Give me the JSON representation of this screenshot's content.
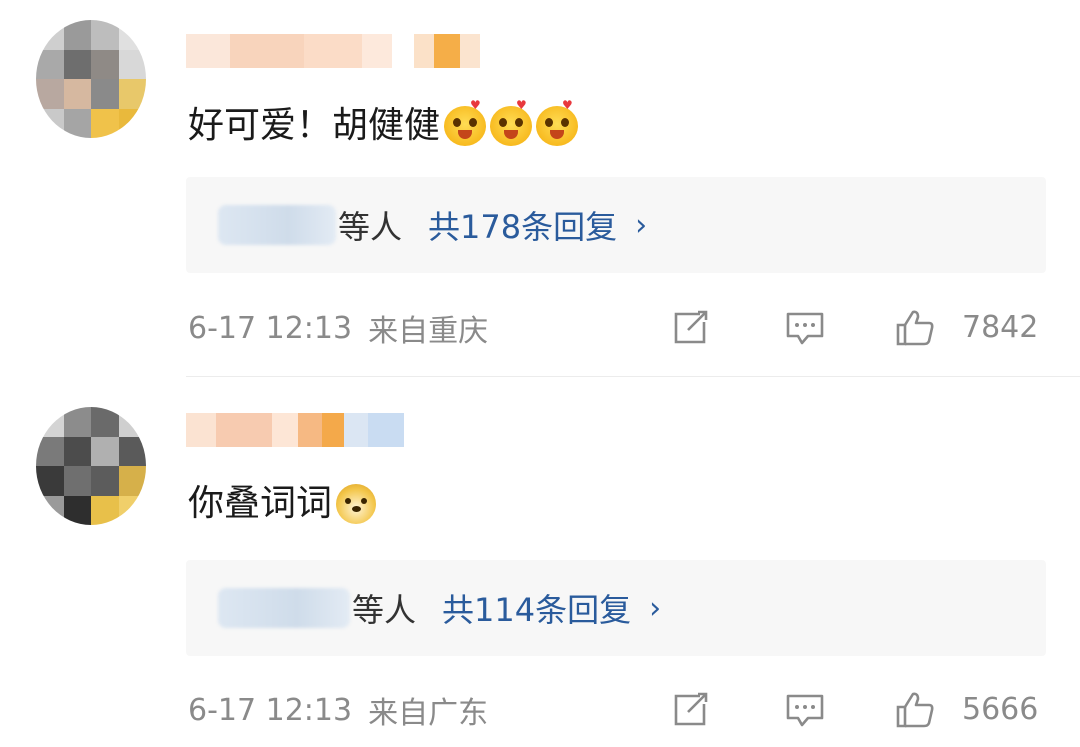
{
  "comments": [
    {
      "text": "好可爱！胡健健",
      "emojis": [
        "blush-heart-emoji",
        "blush-heart-emoji",
        "blush-heart-emoji"
      ],
      "reply_people": "等人",
      "reply_count": "共178条回复",
      "reply_arrow": "›",
      "time": "6-17 12:13",
      "location": "来自重庆",
      "likes": "7842"
    },
    {
      "text": "你叠词词",
      "emojis": [
        "doge-emoji"
      ],
      "reply_people": "等人",
      "reply_count": "共114条回复",
      "reply_arrow": "›",
      "time": "6-17 12:13",
      "location": "来自广东",
      "likes": "5666"
    }
  ],
  "colors": {
    "reply_link": "#2a5b9c",
    "meta_gray": "#8a8a8a",
    "reply_bg": "#f7f7f7"
  },
  "icons": [
    "share-icon",
    "comment-icon",
    "like-icon"
  ]
}
